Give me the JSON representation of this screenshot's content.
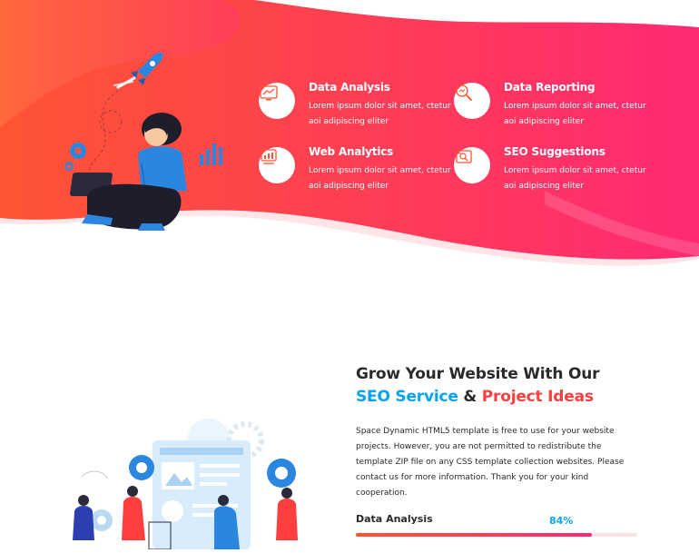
{
  "features": [
    {
      "title": "Data Analysis",
      "desc": "Lorem ipsum dolor sit amet, ctetur aoi adipiscing eliter",
      "icon": "data-analysis-icon"
    },
    {
      "title": "Data Reporting",
      "desc": "Lorem ipsum dolor sit amet, ctetur aoi adipiscing eliter",
      "icon": "data-reporting-icon"
    },
    {
      "title": "Web Analytics",
      "desc": "Lorem ipsum dolor sit amet, ctetur aoi adipiscing eliter",
      "icon": "web-analytics-icon"
    },
    {
      "title": "SEO Suggestions",
      "desc": "Lorem ipsum dolor sit amet, ctetur aoi adipiscing eliter",
      "icon": "seo-suggestions-icon"
    }
  ],
  "about": {
    "heading_line1": "Grow Your Website With Our",
    "heading_blue": "SEO Service",
    "heading_amp": "&",
    "heading_red": "Project Ideas",
    "paragraph": "Space Dynamic HTML5 template is free to use for your website projects. However, you are not permitted to redistribute the template ZIP file on any CSS template collection websites. Please contact us for more information. Thank you for your kind cooperation."
  },
  "skills": [
    {
      "name": "Data Analysis",
      "percent_label": "84%",
      "percent": 84
    }
  ],
  "colors": {
    "hero_start": "#fe5433",
    "hero_end": "#ff2a74",
    "accent_blue": "#03a4ed",
    "accent_red": "#fe3f40",
    "text_dark": "#2a2a2a"
  }
}
